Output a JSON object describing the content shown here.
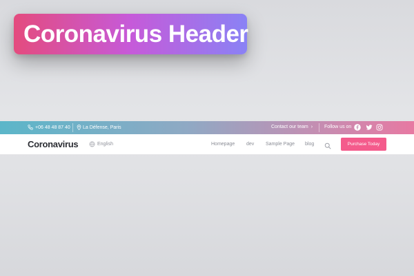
{
  "banner": {
    "title": "Coronavirus Header"
  },
  "topbar": {
    "phone": "+06 48 48 87 40",
    "address": "La Défense, Paris",
    "contact_label": "Contact our team",
    "contact_chevron": "›",
    "follow_label": "Follow us on",
    "social_icons": [
      "facebook-icon",
      "twitter-icon",
      "instagram-icon"
    ],
    "gradient": [
      "#5bb6c9",
      "#8fa9c4",
      "#c28fb3",
      "#e779a2"
    ]
  },
  "navbar": {
    "logo": "Coronavirus",
    "language": "English",
    "links": [
      "Homepage",
      "dev",
      "Sample Page",
      "blog"
    ],
    "cta_label": "Purchase Today",
    "cta_color": "#f45b8c"
  },
  "colors": {
    "banner_gradient": [
      "#e44b7e",
      "#c65ad9",
      "#8a82f5"
    ],
    "text_dark": "#2b2d33",
    "text_muted": "#8a8c95"
  }
}
